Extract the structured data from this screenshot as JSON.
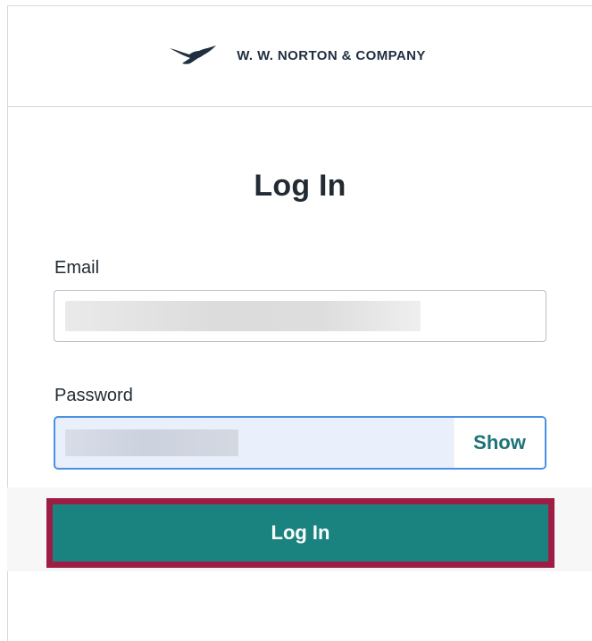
{
  "header": {
    "brand_name": "W. W. NORTON & COMPANY",
    "logo_icon": "bird-logo-icon"
  },
  "form": {
    "title": "Log In",
    "email": {
      "label": "Email"
    },
    "password": {
      "label": "Password",
      "toggle_label": "Show"
    },
    "submit_label": "Log In"
  },
  "colors": {
    "accent": "#1a8380",
    "highlight_border": "#9d1d45",
    "focus_border": "#4a90e2",
    "text": "#222b34",
    "show_text": "#1d7377"
  }
}
